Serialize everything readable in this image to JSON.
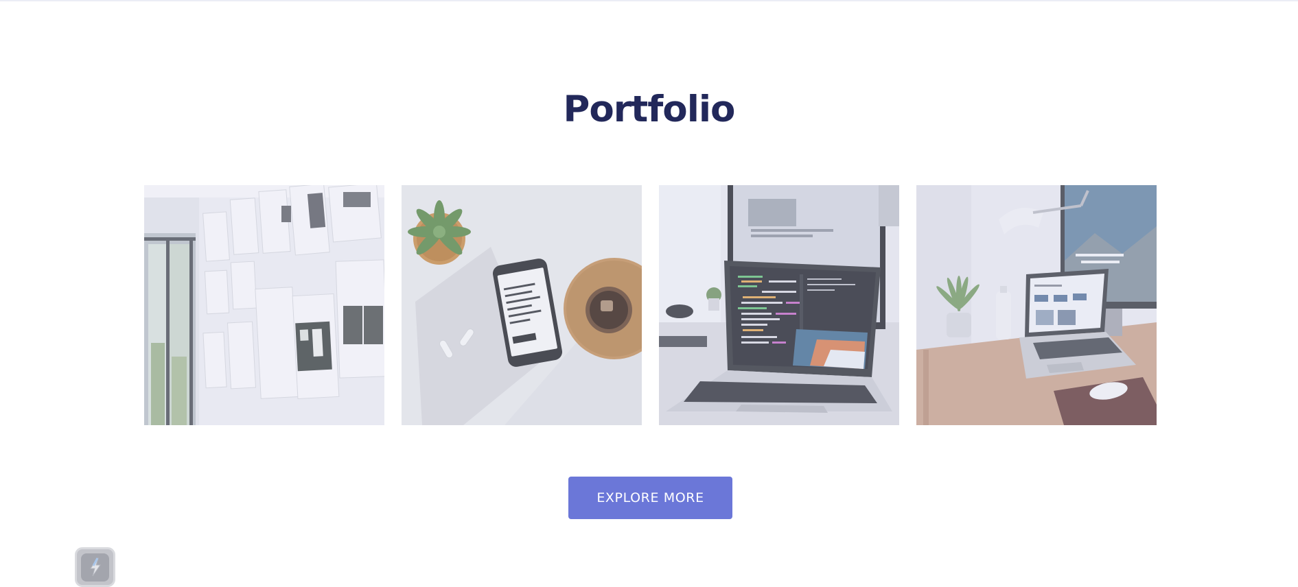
{
  "section": {
    "title": "Portfolio"
  },
  "gallery": {
    "items": [
      {
        "icon": "photo-wall-of-paper-prints"
      },
      {
        "icon": "photo-phone-succulent-coffee"
      },
      {
        "icon": "photo-laptop-code-editor"
      },
      {
        "icon": "photo-desk-laptop-monitor"
      }
    ]
  },
  "cta": {
    "label": "EXPLORE MORE"
  },
  "widget": {
    "icon": "lightning-bolt-icon"
  },
  "colors": {
    "title": "#22285a",
    "button": "#6b77d8",
    "overlay": "#d9dbf2"
  }
}
